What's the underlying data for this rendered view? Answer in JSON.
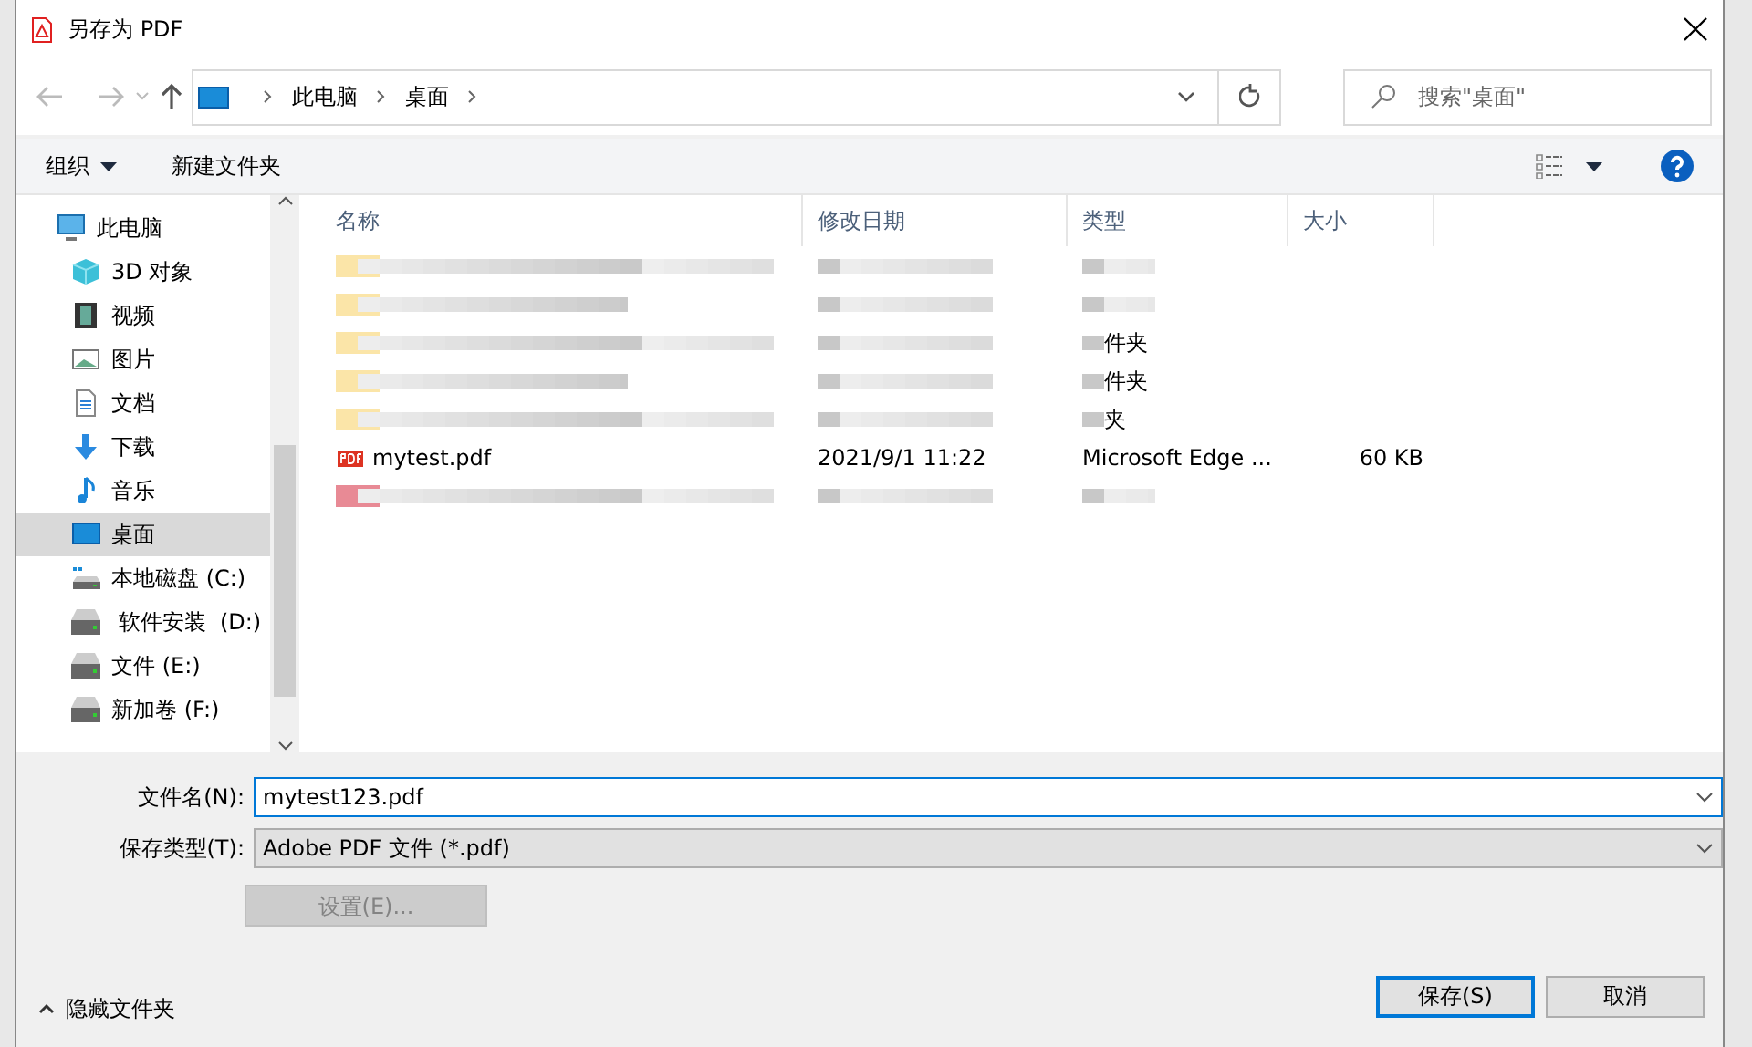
{
  "window": {
    "title": "另存为 PDF"
  },
  "breadcrumb": [
    "此电脑",
    "桌面"
  ],
  "search": {
    "placeholder": "搜索\"桌面\""
  },
  "toolbar": {
    "organize": "组织",
    "new_folder": "新建文件夹"
  },
  "sidebar": {
    "items": [
      {
        "label": "此电脑",
        "kind": "pc",
        "selected": false
      },
      {
        "label": "3D 对象",
        "kind": "cube",
        "selected": false
      },
      {
        "label": "视频",
        "kind": "video",
        "selected": false
      },
      {
        "label": "图片",
        "kind": "image",
        "selected": false
      },
      {
        "label": "文档",
        "kind": "doc",
        "selected": false
      },
      {
        "label": "下载",
        "kind": "download",
        "selected": false
      },
      {
        "label": "音乐",
        "kind": "music",
        "selected": false
      },
      {
        "label": "桌面",
        "kind": "desktop",
        "selected": true
      },
      {
        "label": "本地磁盘 (C:)",
        "kind": "sysdrive",
        "selected": false
      },
      {
        "label": " 软件安装  (D:)",
        "kind": "drive",
        "selected": false
      },
      {
        "label": "文件 (E:)",
        "kind": "drive",
        "selected": false
      },
      {
        "label": "新加卷 (F:)",
        "kind": "drive",
        "selected": false
      }
    ]
  },
  "table": {
    "columns": [
      "名称",
      "修改日期",
      "类型",
      "大小"
    ],
    "rows": [
      {
        "kind": "redacted"
      },
      {
        "kind": "redacted"
      },
      {
        "kind": "redacted",
        "type": "件夹"
      },
      {
        "kind": "redacted",
        "type": "件夹"
      },
      {
        "kind": "redacted",
        "type": "夹"
      },
      {
        "kind": "pdf",
        "name": "mytest.pdf",
        "date": "2021/9/1 11:22",
        "type": "Microsoft Edge ...",
        "size": "60 KB"
      },
      {
        "kind": "redacted"
      }
    ]
  },
  "form": {
    "filename_label": "文件名(N):",
    "filename": "mytest123.pdf",
    "filetype_label": "保存类型(T):",
    "filetype": "Adobe PDF 文件 (*.pdf)",
    "settings": {
      "label": "设置(E)...",
      "disabled": true
    }
  },
  "hide_folders": "隐藏文件夹",
  "buttons": [
    {
      "label": "保存(S)",
      "default": true
    },
    {
      "label": "取消",
      "default": false
    }
  ]
}
